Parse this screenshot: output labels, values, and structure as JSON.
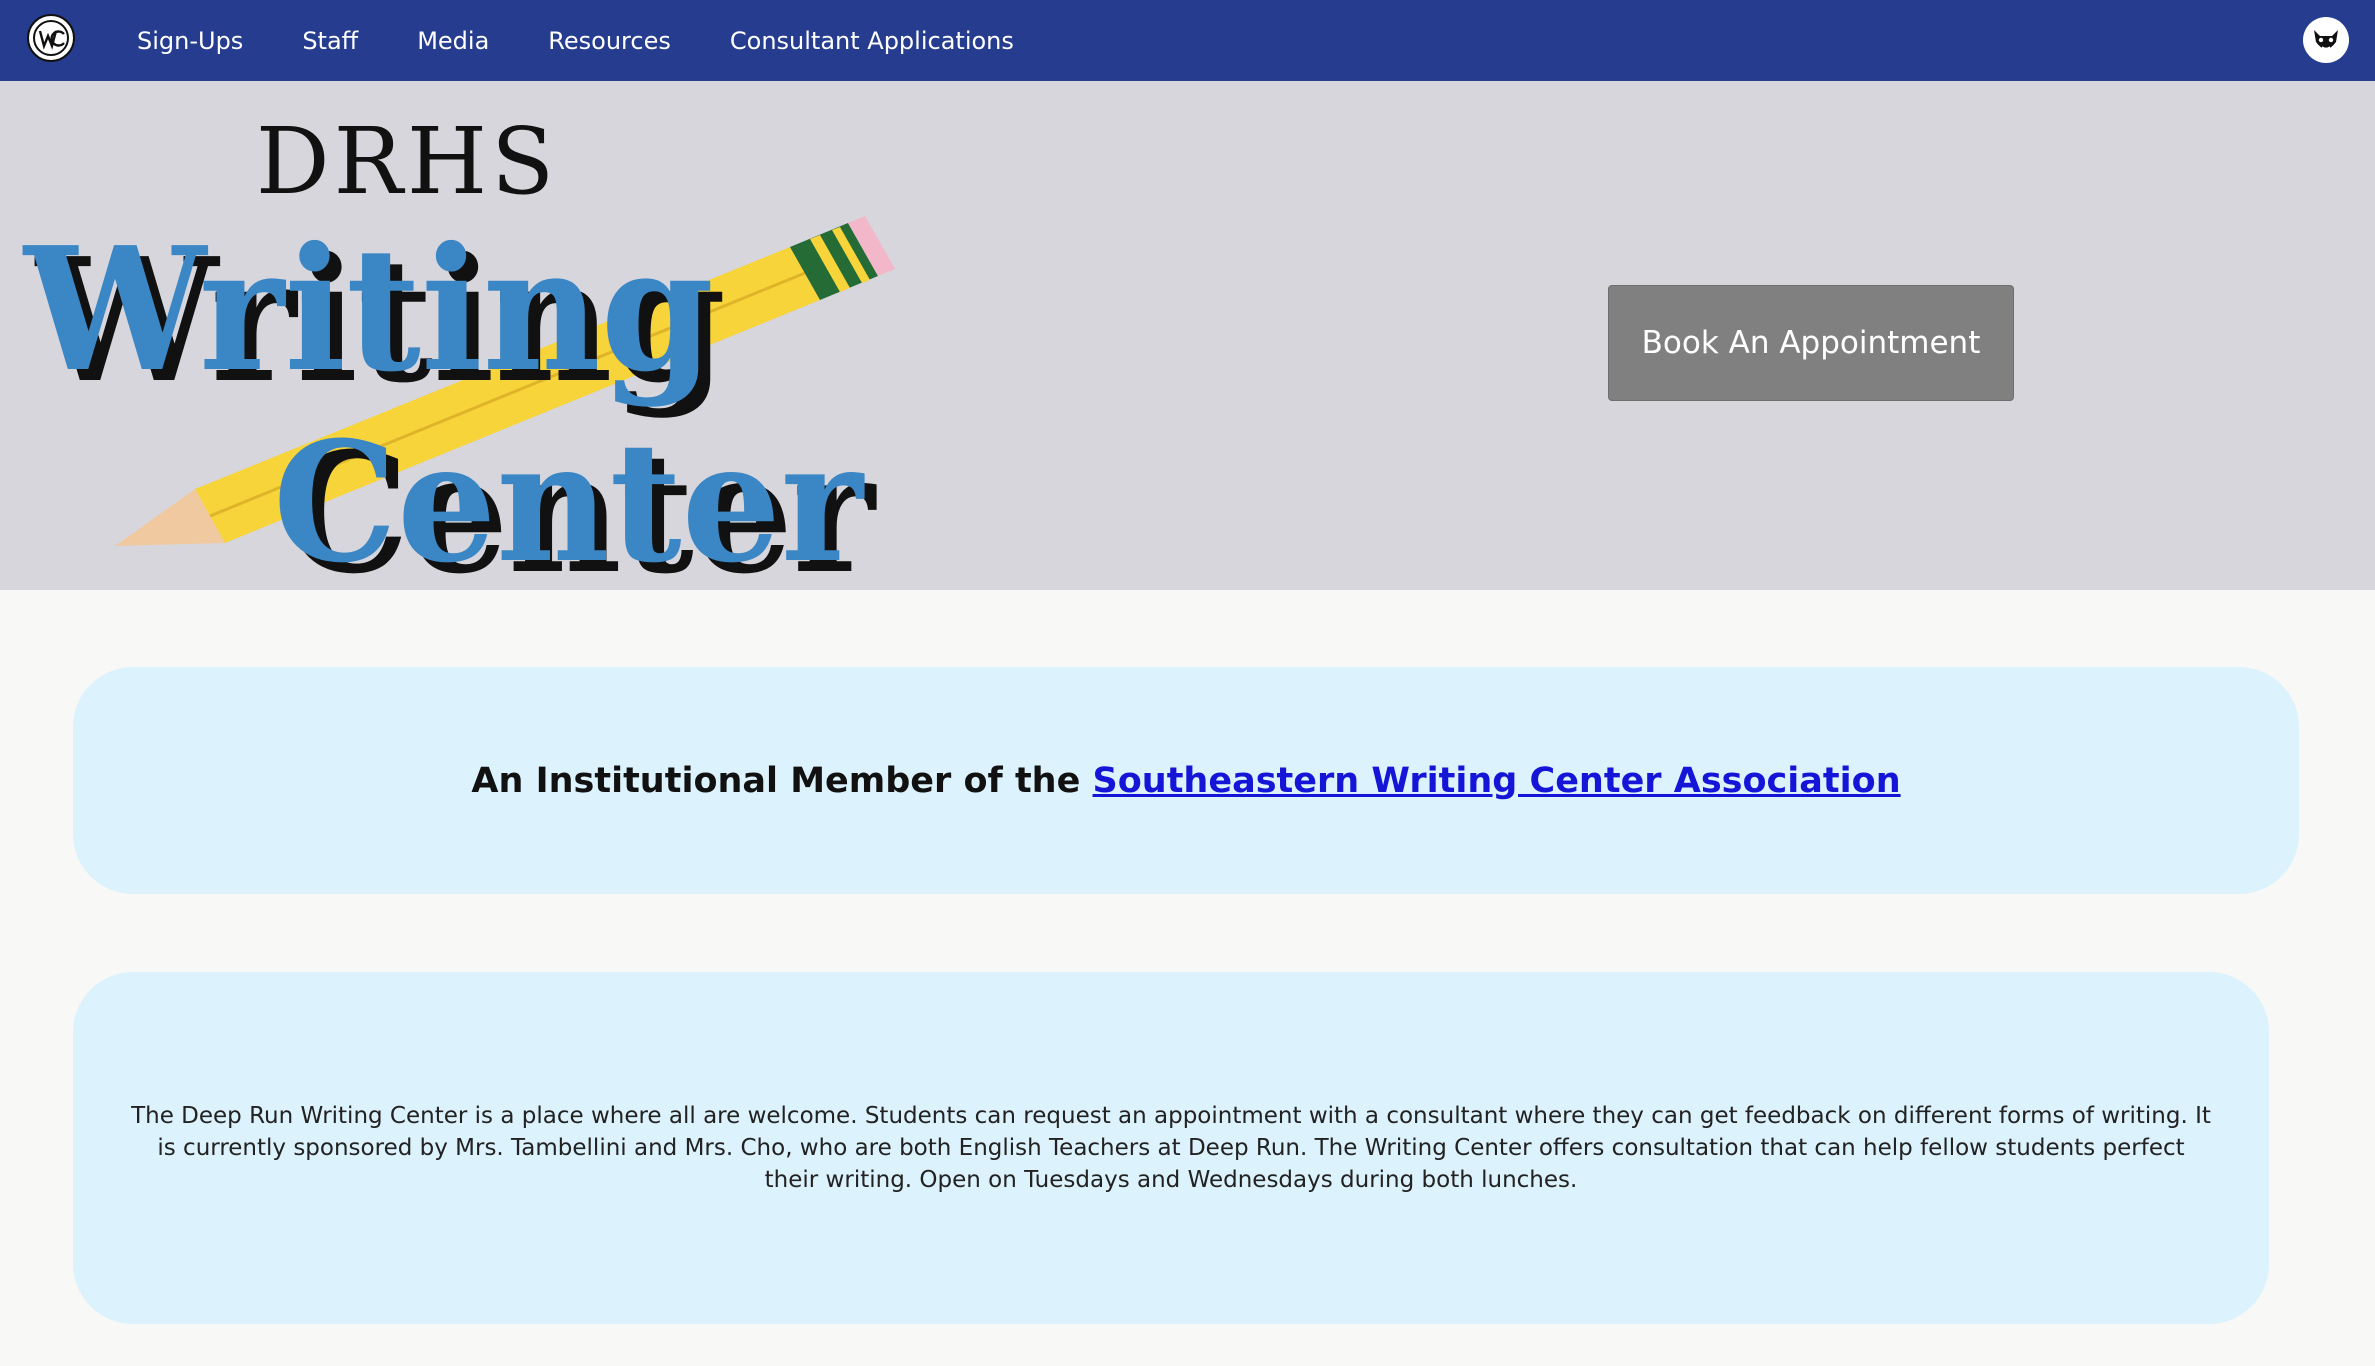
{
  "nav": {
    "logo_icon": "writing-center-circle-logo",
    "items": [
      {
        "label": "Sign-Ups"
      },
      {
        "label": "Staff"
      },
      {
        "label": "Media"
      },
      {
        "label": "Resources"
      },
      {
        "label": "Consultant Applications"
      }
    ],
    "avatar_icon": "wildcat-mascot-avatar"
  },
  "hero": {
    "logo": {
      "line1": "DRHS",
      "line2": "Writing",
      "line3": "Center"
    },
    "book_label": "Book An Appointment"
  },
  "member": {
    "prefix": "An Institutional Member of the",
    "link_text": "Southeastern Writing Center Association"
  },
  "about": {
    "text": "The Deep Run Writing Center is a place where all are welcome. Students can request an appointment with a consultant where they can get feedback on different forms of writing. It is currently sponsored by Mrs. Tambellini and Mrs. Cho, who are both English Teachers at Deep Run. The Writing Center offers consultation that can help fellow students perfect their writing. Open on Tuesdays and Wednesdays during both lunches."
  },
  "colors": {
    "nav_bg": "#253c8f",
    "hero_bg": "#d6d6dc",
    "card_bg": "#dcf2fc",
    "logo_blue": "#3b86c4",
    "pencil_yellow": "#f7d43a",
    "link": "#1515d8",
    "button_bg": "#808080"
  }
}
